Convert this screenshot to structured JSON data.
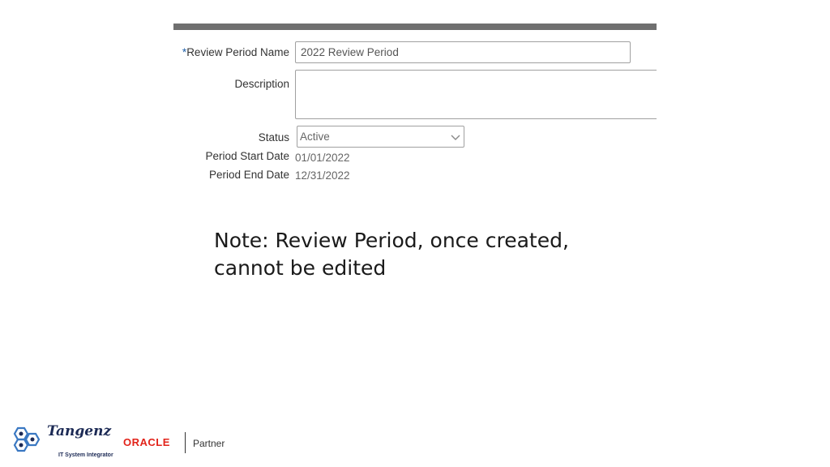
{
  "form": {
    "review_period_name": {
      "required_marker": "*",
      "label": "Review Period Name",
      "value": "2022 Review Period"
    },
    "description": {
      "label": "Description",
      "value": ""
    },
    "status": {
      "label": "Status",
      "selected": "Active"
    },
    "period_start_date": {
      "label": "Period Start Date",
      "value": "01/01/2022"
    },
    "period_end_date": {
      "label": "Period End Date",
      "value": "12/31/2022"
    }
  },
  "note": {
    "text": "Note: Review Period, once created, cannot be edited"
  },
  "footer": {
    "brand_name": "Tangenz",
    "brand_tagline": "IT System Integrator",
    "oracle_logo": "ORACLE",
    "partner_label": "Partner"
  },
  "colors": {
    "required_marker": "#1f5fa8",
    "top_bar": "#6f6f6f",
    "oracle_red": "#e2231a",
    "brand_navy": "#1c2a55",
    "hex_blue": "#3a78c2"
  },
  "icons": {
    "status_dropdown": "chevron-down-icon",
    "brand_logo": "hexagon-cluster-icon"
  }
}
